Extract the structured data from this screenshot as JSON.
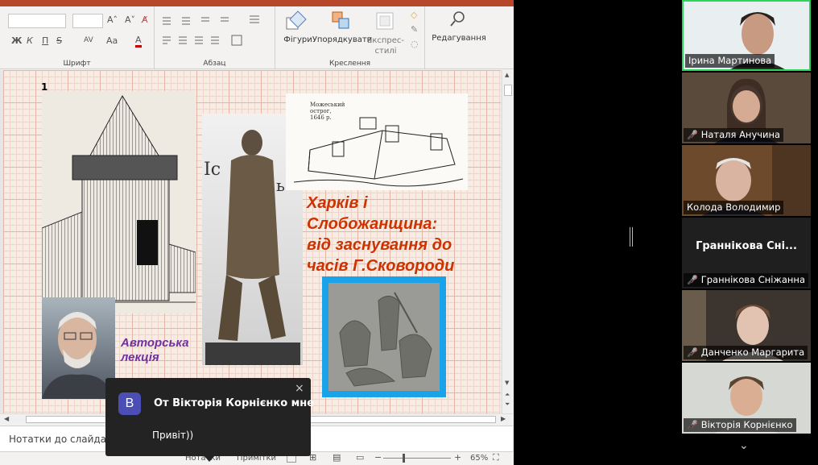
{
  "ribbon": {
    "groups": {
      "font_label": "Шрифт",
      "paragraph_label": "Абзац",
      "drawing_label": "Креслення"
    },
    "buttons": {
      "shapes": "Фігури",
      "arrange": "Упорядкувати",
      "quick_styles_1": "Експрес-",
      "quick_styles_2": "стилі",
      "editing": "Редагування"
    },
    "font_format": {
      "bold": "Ж",
      "italic": "К",
      "underline": "П",
      "strike": "S",
      "spacing": "AV",
      "case": "Aa",
      "color": "A"
    }
  },
  "slide": {
    "number": "1",
    "title_lines": [
      "Харків і",
      "Слобожанщина:",
      "від заснування до",
      "часів Г.Сковороди"
    ],
    "author_lecture_lines": [
      "Авторська",
      "лекція"
    ],
    "fort_caption_lines": [
      "Можеський",
      "острог,",
      "1646 р."
    ]
  },
  "notes": {
    "label": "Нотатки до слайда"
  },
  "status_bar": {
    "notes_btn": "Нотатки",
    "comments_btn": "Примітки",
    "zoom_minus": "−",
    "zoom_plus": "+",
    "zoom": "65%"
  },
  "toast": {
    "avatar_letter": "В",
    "title": "От Вікторія Корнієнко мне",
    "message": "Привіт))",
    "close": "×"
  },
  "participants": [
    {
      "name": "Ірина Мартинова",
      "muted": false,
      "active": true,
      "video": true
    },
    {
      "name": "Наталя Анучина",
      "muted": true,
      "active": false,
      "video": true
    },
    {
      "name": "Колода Володимир",
      "muted": false,
      "active": false,
      "video": true
    },
    {
      "name": "Граннікова Сніжанна",
      "display_name": "Граннікова Сні...",
      "muted": true,
      "active": false,
      "video": false
    },
    {
      "name": "Данченко Маргарита",
      "muted": true,
      "active": false,
      "video": true
    },
    {
      "name": "Вікторія Корнієнко",
      "muted": true,
      "active": false,
      "video": true
    }
  ],
  "colors": {
    "ppt_accent": "#b7472a",
    "title_red": "#cc3300",
    "author_purple": "#7030a0",
    "active_speaker": "#2bd45b",
    "mic_off": "#e53935"
  }
}
